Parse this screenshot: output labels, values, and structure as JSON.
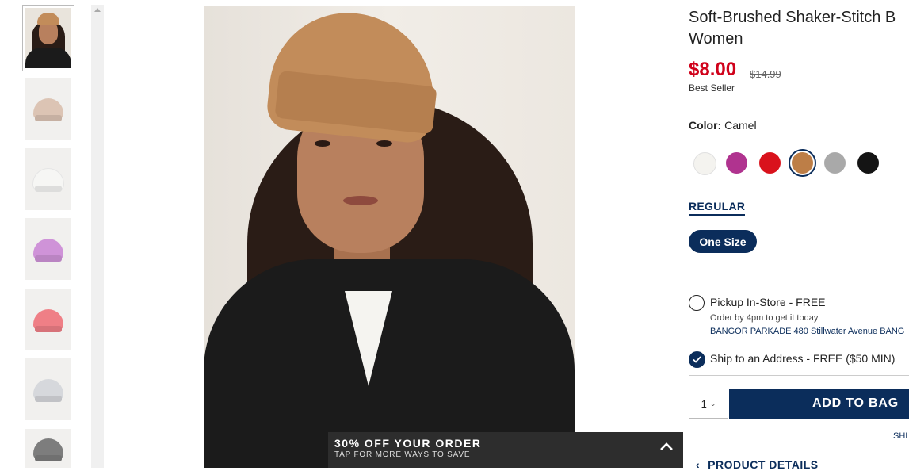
{
  "product": {
    "title_line1": "Soft-Brushed Shaker-Stitch B",
    "title_line2": "Women",
    "price": "$8.00",
    "original_price": "$14.99",
    "badge": "Best Seller"
  },
  "color": {
    "label": "Color:",
    "selected": "Camel",
    "swatches": [
      {
        "name": "cream",
        "hex": "#f4f3ef"
      },
      {
        "name": "magenta",
        "hex": "#b0338f"
      },
      {
        "name": "red",
        "hex": "#d9121c"
      },
      {
        "name": "camel",
        "hex": "#bd7e47"
      },
      {
        "name": "heather-gray",
        "hex": "#a9a9a9"
      },
      {
        "name": "black",
        "hex": "#141414"
      }
    ]
  },
  "size": {
    "tab": "REGULAR",
    "option": "One Size"
  },
  "fulfillment": {
    "pickup_label": "Pickup In-Store - FREE",
    "pickup_sub": "Order by 4pm to get it today",
    "store": "BANGOR PARKADE 480 Stillwater Avenue  BANG",
    "ship_label": "Ship to an Address - FREE ($50 MIN)"
  },
  "cart": {
    "quantity": "1",
    "add_label": "ADD TO BAG",
    "shi_text": "SHI"
  },
  "details_label": "PRODUCT DETAILS",
  "promo": {
    "title": "30% OFF YOUR ORDER",
    "subtitle": "TAP FOR MORE WAYS TO SAVE"
  },
  "thumbnails": [
    {
      "name": "model",
      "hex": "#c28c5a"
    },
    {
      "name": "beige",
      "hex": "#dcc4b4"
    },
    {
      "name": "white",
      "hex": "#f6f6f4"
    },
    {
      "name": "lavender",
      "hex": "#cf93d8"
    },
    {
      "name": "coral",
      "hex": "#ef7f86"
    },
    {
      "name": "light-gray",
      "hex": "#d6d8dc"
    },
    {
      "name": "charcoal",
      "hex": "#7d7d7d"
    }
  ]
}
